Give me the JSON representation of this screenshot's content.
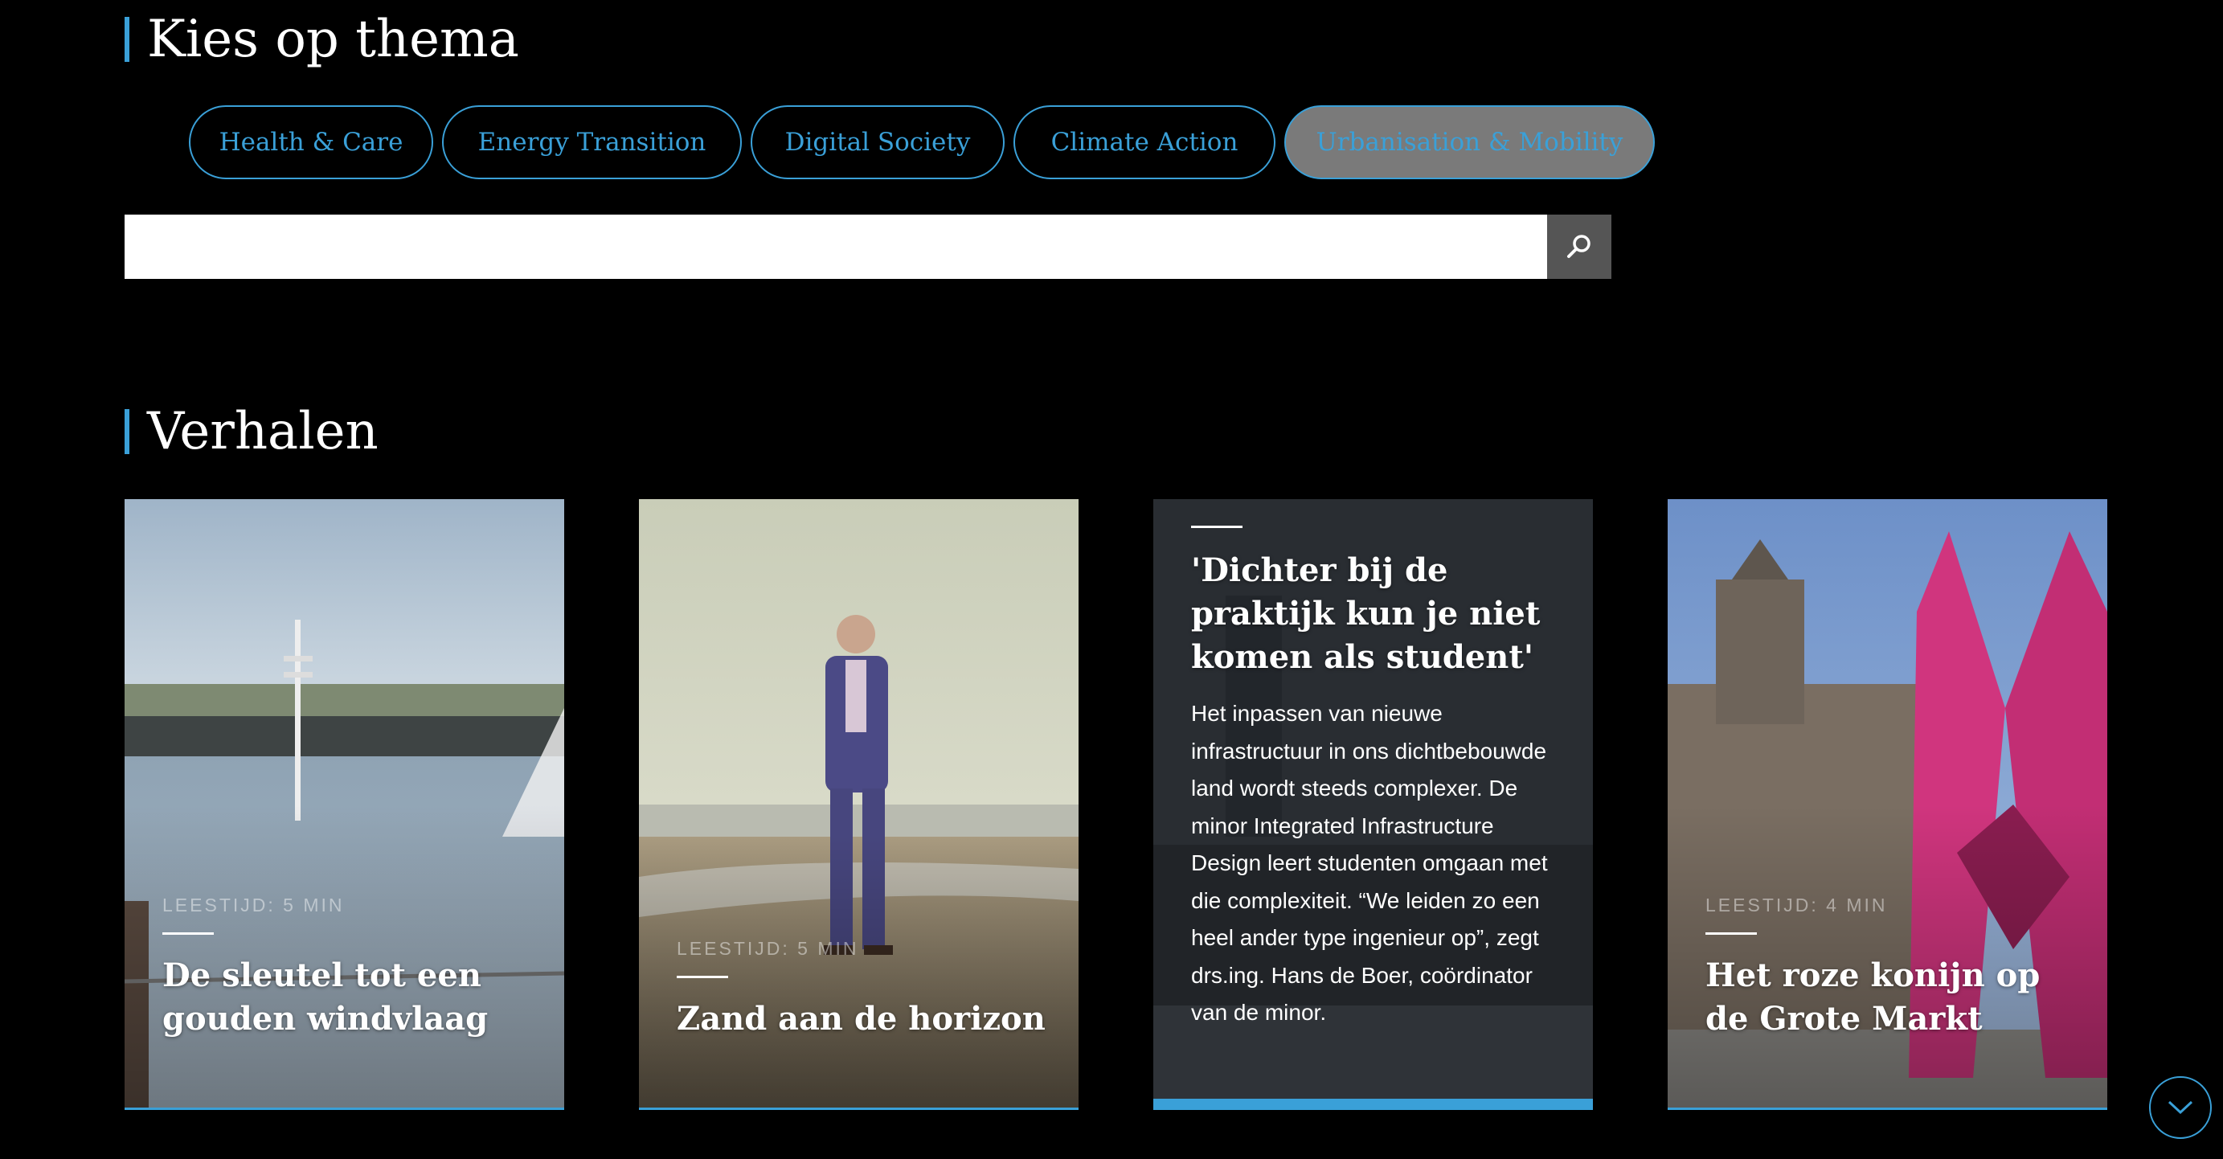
{
  "theme_section": {
    "title": "Kies op thema",
    "tabs": [
      {
        "label": "Health & Care",
        "active": false
      },
      {
        "label": "Energy Transition",
        "active": false
      },
      {
        "label": "Digital Society",
        "active": false
      },
      {
        "label": "Climate Action",
        "active": false
      },
      {
        "label": "Urbanisation & Mobility",
        "active": true
      }
    ]
  },
  "search": {
    "value": "",
    "icon": "search-icon"
  },
  "stories": {
    "title": "Verhalen",
    "cards": [
      {
        "read_time": "LEESTIJD: 5 MIN",
        "title": "De sleutel tot een gouden windvlaag",
        "summary": ""
      },
      {
        "read_time": "LEESTIJD: 5 MIN",
        "title": "Zand aan de horizon",
        "summary": ""
      },
      {
        "read_time": "",
        "title": "'Dichter bij de praktijk kun je niet komen als student'",
        "summary": "Het inpassen van nieuwe infrastructuur in ons dichtbebouwde land wordt steeds complexer. De minor Integrated Infrastructure Design leert studenten omgaan met die complexiteit. “We leiden zo een heel ander type ingenieur op”, zegt drs.ing. Hans de Boer, coördinator van de minor."
      },
      {
        "read_time": "LEESTIJD: 4 MIN",
        "title": "Het roze konijn op de Grote Markt",
        "summary": ""
      }
    ]
  },
  "scroll_button": {
    "icon": "chevron-down-icon"
  },
  "colors": {
    "accent": "#3aa0d8",
    "background": "#000000",
    "active_tab": "#7a7a7a"
  }
}
